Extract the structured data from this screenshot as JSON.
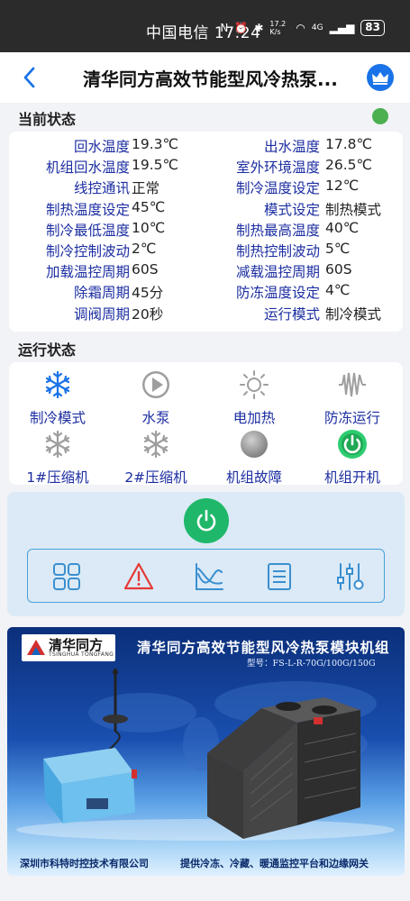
{
  "status_bar": {
    "carrier_time": "中国电信 17:24",
    "network": "17.2 K/s",
    "signal": "4G",
    "battery": "83"
  },
  "header": {
    "title": "清华同方高效节能型风冷热泵...",
    "back_icon": "chevron-left-icon",
    "crown_icon": "crown-icon",
    "accent": "#1a73e8"
  },
  "current_status": {
    "title": "当前状态",
    "online_color": "#4caf50",
    "rows": [
      {
        "label1": "回水温度",
        "value1": "19.3℃",
        "label2": "出水温度",
        "value2": "17.8℃"
      },
      {
        "label1": "机组回水温度",
        "value1": "19.5℃",
        "label2": "室外环境温度",
        "value2": "26.5℃"
      },
      {
        "label1": "线控通讯",
        "value1": "正常",
        "label2": "制冷温度设定",
        "value2": "12℃"
      },
      {
        "label1": "制热温度设定",
        "value1": "45℃",
        "label2": "模式设定",
        "value2": "制热模式"
      },
      {
        "label1": "制冷最低温度",
        "value1": "10℃",
        "label2": "制热最高温度",
        "value2": "40℃"
      },
      {
        "label1": "制冷控制波动",
        "value1": "2℃",
        "label2": "制热控制波动",
        "value2": "5℃"
      },
      {
        "label1": "加载温控周期",
        "value1": "60S",
        "label2": "减载温控周期",
        "value2": "60S"
      },
      {
        "label1": "除霜周期",
        "value1": "45分",
        "label2": "防冻温度设定",
        "value2": "4℃"
      },
      {
        "label1": "调阀周期",
        "value1": "20秒",
        "label2": "运行模式",
        "value2": "制冷模式"
      }
    ]
  },
  "run_status": {
    "title": "运行状态",
    "items": [
      {
        "label": "制冷模式",
        "icon": "snowflake-icon",
        "active": true
      },
      {
        "label": "水泵",
        "icon": "pump-play-icon",
        "active": false
      },
      {
        "label": "电加热",
        "icon": "sun-icon",
        "active": false
      },
      {
        "label": "防冻运行",
        "icon": "coil-icon",
        "active": false
      },
      {
        "label": "1#压缩机",
        "icon": "snowflake-icon",
        "active": false
      },
      {
        "label": "2#压缩机",
        "icon": "snowflake-icon",
        "active": false
      },
      {
        "label": "机组故障",
        "icon": "fault-dot-icon",
        "active": false
      },
      {
        "label": "机组开机",
        "icon": "power-icon",
        "active": true
      }
    ]
  },
  "controls": {
    "power_icon": "power-icon",
    "power_color": "#1fb86a",
    "toolbar": [
      "grid-icon",
      "alarm-icon",
      "chart-icon",
      "list-icon",
      "settings-sliders-icon"
    ]
  },
  "banner": {
    "brand_name": "清华同方",
    "brand_sub": "TSINGHUA TONGFANG",
    "title": "清华同方高效节能型风冷热泵模块机组",
    "model": "型号：FS-L-R-70G/100G/150G",
    "footer_left": "深圳市科特时控技术有限公司",
    "footer_right": "提供冷冻、冷藏、暖通监控平台和边缘网关"
  }
}
